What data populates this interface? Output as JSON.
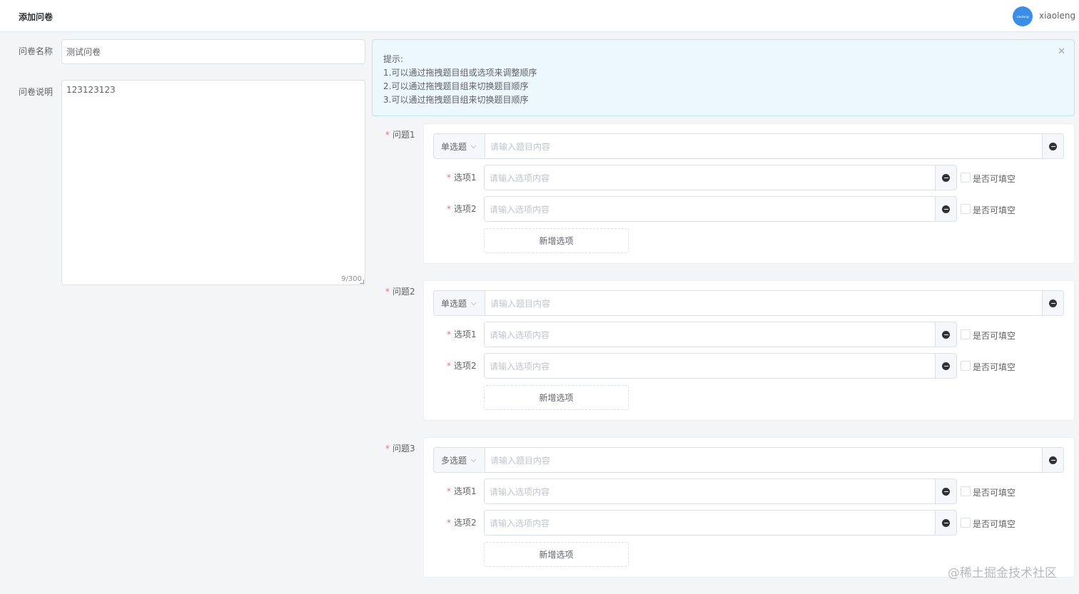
{
  "header": {
    "title": "添加问卷",
    "avatar_text": "xiaoleng",
    "username": "xiaoleng"
  },
  "form": {
    "name_label": "问卷名称",
    "name_value": "测试问卷",
    "desc_label": "问卷说明",
    "desc_value": "123123123",
    "desc_counter": "9/300"
  },
  "alert": {
    "title": "提示:",
    "lines": [
      "1.可以通过拖拽题目组或选项来调整顺序",
      "2.可以通过拖拽题目组来切换题目顺序",
      "3.可以通过拖拽题目组来切换题目顺序"
    ],
    "close_icon": "close-icon"
  },
  "questions": [
    {
      "label": "问题1",
      "type": "单选题",
      "placeholder": "请输入题目内容",
      "options": [
        {
          "label": "选项1",
          "placeholder": "请输入选项内容",
          "checkbox_label": "是否可填空"
        },
        {
          "label": "选项2",
          "placeholder": "请输入选项内容",
          "checkbox_label": "是否可填空"
        }
      ],
      "add_label": "新增选项"
    },
    {
      "label": "问题2",
      "type": "单选题",
      "placeholder": "请输入题目内容",
      "options": [
        {
          "label": "选项1",
          "placeholder": "请输入选项内容",
          "checkbox_label": "是否可填空"
        },
        {
          "label": "选项2",
          "placeholder": "请输入选项内容",
          "checkbox_label": "是否可填空"
        }
      ],
      "add_label": "新增选项"
    },
    {
      "label": "问题3",
      "type": "多选题",
      "placeholder": "请输入题目内容",
      "options": [
        {
          "label": "选项1",
          "placeholder": "请输入选项内容",
          "checkbox_label": "是否可填空"
        },
        {
          "label": "选项2",
          "placeholder": "请输入选项内容",
          "checkbox_label": "是否可填空"
        }
      ],
      "add_label": "新增选项"
    }
  ],
  "watermark": "@稀土掘金技术社区",
  "colors": {
    "accent": "#3a8ee6",
    "required": "#f56c6c",
    "alert_bg": "#ecf8fd"
  }
}
